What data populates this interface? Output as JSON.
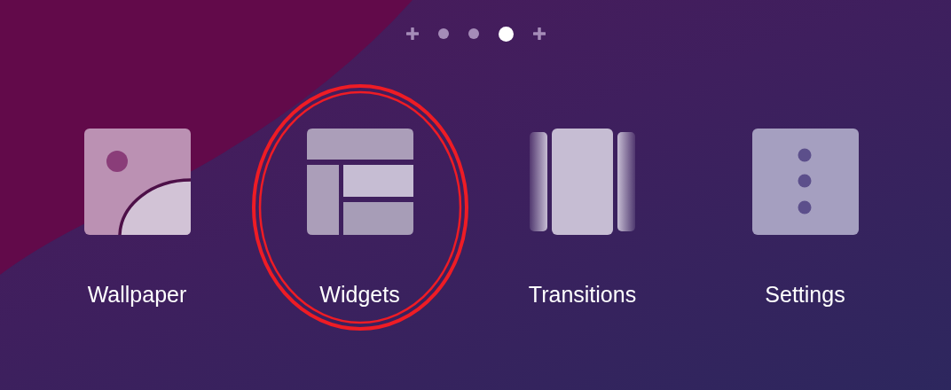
{
  "page_indicator": [
    {
      "kind": "add",
      "selected": false
    },
    {
      "kind": "dot",
      "selected": false
    },
    {
      "kind": "dot",
      "selected": false
    },
    {
      "kind": "dot",
      "selected": true
    },
    {
      "kind": "add",
      "selected": false
    }
  ],
  "shortcuts": [
    {
      "kind": "wallpaper",
      "label": "Wallpaper",
      "circled": false
    },
    {
      "kind": "widgets",
      "label": "Widgets",
      "circled": true
    },
    {
      "kind": "transitions",
      "label": "Transitions",
      "circled": false
    },
    {
      "kind": "settings",
      "label": "Settings",
      "circled": false
    }
  ]
}
